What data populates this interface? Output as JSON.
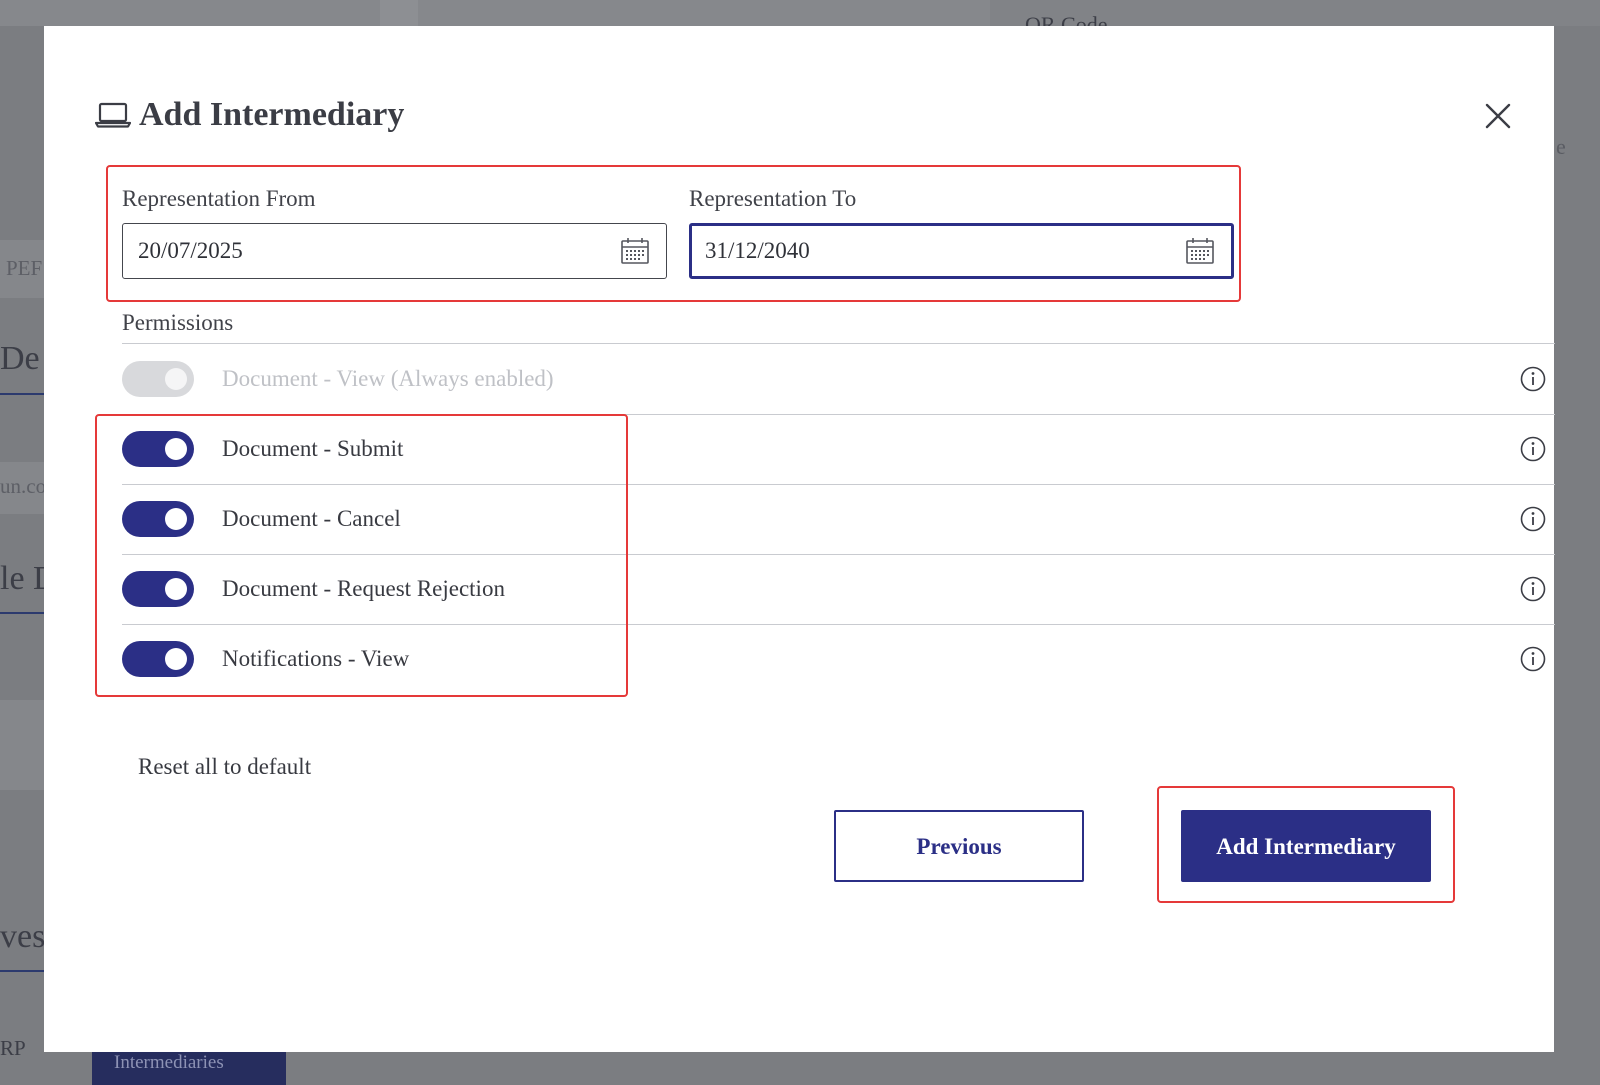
{
  "background": {
    "top_text": "QR Code",
    "left_labels": [
      "PEF",
      "De",
      "un.co",
      "le D",
      "ves",
      "RP"
    ],
    "right_label": "e",
    "bottom_button": "Intermediaries"
  },
  "modal": {
    "title": "Add Intermediary",
    "title_icon": "laptop-icon",
    "close_icon": "close-icon",
    "representation_from": {
      "label": "Representation From",
      "value": "20/07/2025",
      "icon": "calendar-icon"
    },
    "representation_to": {
      "label": "Representation To",
      "value": "31/12/2040",
      "icon": "calendar-icon",
      "focused": true
    },
    "permissions": {
      "title": "Permissions",
      "items": [
        {
          "label": "Document - View (Always enabled)",
          "enabled": true,
          "disabled": true,
          "icon": "info-icon"
        },
        {
          "label": "Document - Submit",
          "enabled": true,
          "disabled": false,
          "icon": "info-icon"
        },
        {
          "label": "Document - Cancel",
          "enabled": true,
          "disabled": false,
          "icon": "info-icon"
        },
        {
          "label": "Document - Request Rejection",
          "enabled": true,
          "disabled": false,
          "icon": "info-icon"
        },
        {
          "label": "Notifications - View",
          "enabled": true,
          "disabled": false,
          "icon": "info-icon"
        }
      ]
    },
    "reset_label": "Reset all to default",
    "previous_label": "Previous",
    "add_label": "Add Intermediary"
  },
  "colors": {
    "primary": "#2b2f86",
    "highlight": "#e53939",
    "overlay": "#7b7d81"
  }
}
